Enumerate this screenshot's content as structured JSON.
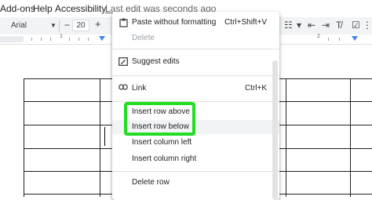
{
  "menubar": {
    "items": [
      "Add-ons",
      "Help",
      "Accessibility"
    ],
    "last_edit": "Last edit was seconds ago"
  },
  "toolbar": {
    "font": "Arial",
    "font_size": "20",
    "minus": "−",
    "plus": "+"
  },
  "ruler": {
    "numbers": [
      "1",
      "2"
    ]
  },
  "context_menu": {
    "paste_plain": {
      "label": "Paste without formatting",
      "shortcut": "Ctrl+Shift+V",
      "icon": "paste-plain-icon"
    },
    "delete": {
      "label": "Delete"
    },
    "suggest_edits": {
      "label": "Suggest edits",
      "icon": "suggest-edits-icon"
    },
    "link": {
      "label": "Link",
      "shortcut": "Ctrl+K",
      "icon": "link-icon"
    },
    "insert_row_above": {
      "label": "Insert row above"
    },
    "insert_row_below": {
      "label": "Insert row below"
    },
    "insert_column_left": {
      "label": "Insert column left"
    },
    "insert_column_right": {
      "label": "Insert column right"
    },
    "delete_row": {
      "label": "Delete row"
    }
  },
  "colors": {
    "highlight": "#22dd22",
    "menu_hover": "#f1f3f4",
    "ruler_marker": "#4285f4"
  }
}
